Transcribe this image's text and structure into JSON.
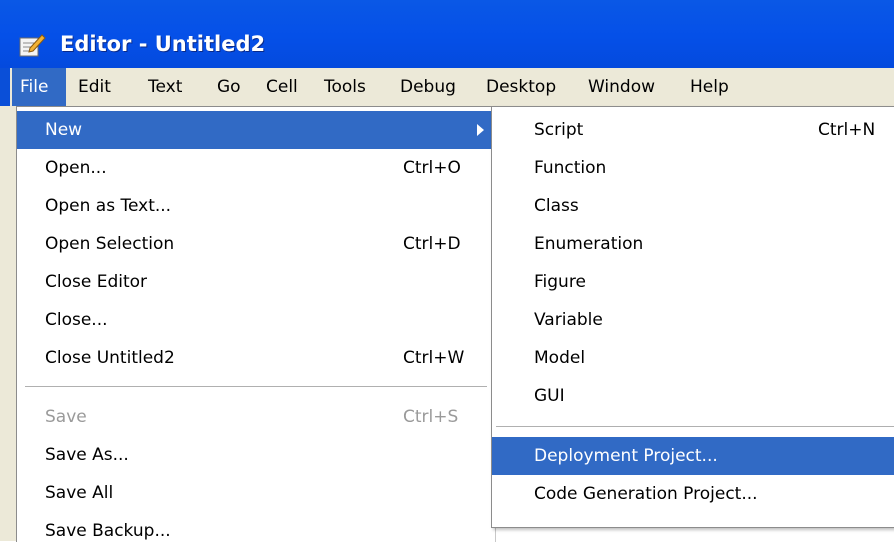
{
  "window": {
    "title": "Editor - Untitled2"
  },
  "menubar": {
    "items": [
      "File",
      "Edit",
      "Text",
      "Go",
      "Cell",
      "Tools",
      "Debug",
      "Desktop",
      "Window",
      "Help"
    ]
  },
  "file_menu": {
    "items": [
      {
        "label": "New",
        "shortcut": ""
      },
      {
        "label": "Open...",
        "shortcut": "Ctrl+O"
      },
      {
        "label": "Open as Text...",
        "shortcut": ""
      },
      {
        "label": "Open Selection",
        "shortcut": "Ctrl+D"
      },
      {
        "label": "Close Editor",
        "shortcut": ""
      },
      {
        "label": "Close...",
        "shortcut": ""
      },
      {
        "label": "Close Untitled2",
        "shortcut": "Ctrl+W"
      },
      {
        "label": "Save",
        "shortcut": "Ctrl+S"
      },
      {
        "label": "Save As...",
        "shortcut": ""
      },
      {
        "label": "Save All",
        "shortcut": ""
      },
      {
        "label": "Save Backup...",
        "shortcut": ""
      }
    ]
  },
  "new_submenu": {
    "items": [
      {
        "label": "Script",
        "shortcut": "Ctrl+N"
      },
      {
        "label": "Function",
        "shortcut": ""
      },
      {
        "label": "Class",
        "shortcut": ""
      },
      {
        "label": "Enumeration",
        "shortcut": ""
      },
      {
        "label": "Figure",
        "shortcut": ""
      },
      {
        "label": "Variable",
        "shortcut": ""
      },
      {
        "label": "Model",
        "shortcut": ""
      },
      {
        "label": "GUI",
        "shortcut": ""
      },
      {
        "label": "Deployment Project...",
        "shortcut": ""
      },
      {
        "label": "Code Generation Project...",
        "shortcut": ""
      }
    ]
  },
  "colors": {
    "titlebar": "#0550e8",
    "highlight": "#316ac5",
    "menubar": "#ece9d8",
    "disabled": "#9a9a9a"
  },
  "icons": {
    "app": "editor-pencil-icon",
    "submenu": "submenu-arrow-icon"
  }
}
